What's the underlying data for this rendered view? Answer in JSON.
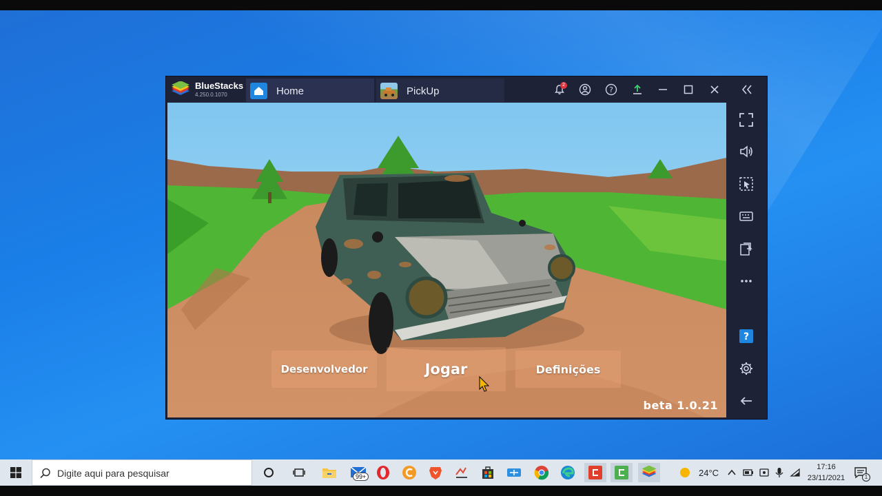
{
  "bluestacks": {
    "brand": "BlueStacks",
    "version": "4.250.0.1070",
    "tabs": [
      {
        "label": "Home"
      },
      {
        "label": "PickUp"
      }
    ],
    "notification_count": "2"
  },
  "game": {
    "menu": {
      "developer": "Desenvolvedor",
      "play": "Jogar",
      "settings": "Definições"
    },
    "version": "beta 1.0.21"
  },
  "taskbar": {
    "search_placeholder": "Digite aqui para pesquisar",
    "mail_badge": "99+",
    "weather": "24°C",
    "time": "17:16",
    "date": "23/11/2021",
    "notification_count": "1"
  },
  "icons": [
    "bluestacks-logo",
    "home-icon",
    "bell-icon",
    "account-icon",
    "help-icon",
    "upload-icon",
    "minimize-icon",
    "maximize-icon",
    "close-icon",
    "collapse-icon",
    "fullscreen-icon",
    "volume-icon",
    "cursor-icon",
    "keyboard-icon",
    "screen-record-icon",
    "more-icon",
    "help-square-icon",
    "gear-icon",
    "back-icon",
    "windows-start-icon",
    "search-icon"
  ]
}
